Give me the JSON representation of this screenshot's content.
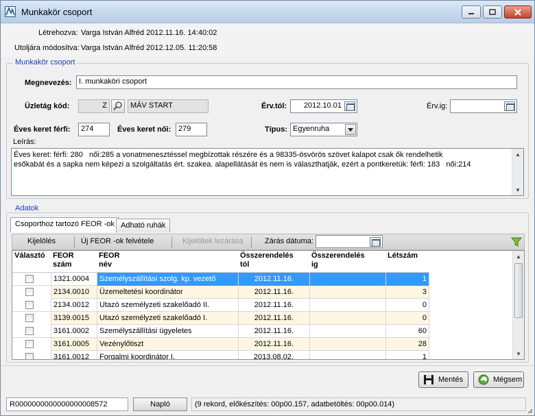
{
  "window": {
    "title": "Munkakör csoport",
    "icon": "app-icon"
  },
  "audit": {
    "created_label": "Létrehozva:",
    "created_value": "Varga István Alfréd 2012.11.16. 14:40:02",
    "modified_label": "Utoljára módosítva:",
    "modified_value": "Varga István Alfréd 2012.12.05. 11:20:58"
  },
  "group_main": {
    "title": "Munkakör csoport",
    "name_label": "Megnevezés:",
    "name_value": "I. munkaköri csoport",
    "branch_label": "Üzletág kód:",
    "branch_code": "Z",
    "branch_name": "MÁV START",
    "valid_from_label": "Érv.tól:",
    "valid_from_value": "2012.10.01",
    "valid_to_label": "Érv.ig:",
    "valid_to_value": "",
    "male_label": "Éves keret férfi:",
    "male_value": "274",
    "female_label": "Éves keret női:",
    "female_value": "279",
    "type_label": "Típus:",
    "type_value": "Egyenruha",
    "desc_label": "Leírás:",
    "desc_value": "Éves keret: férfi: 280   női:285 a vonatmenesztéssel megbízottak részére és a 98335-ösvörös szövet kalapot csak ők rendelhetik\nesőkabát és a sapka nem képezi a szolgáltatás ért. szakea. alapellátását és nem is választhatják, ezért a pontkeretük: férfi: 183   női:214"
  },
  "group_data": {
    "title": "Adatok",
    "tabs": [
      {
        "label": "Csoporthoz tartozó FEOR -ok"
      },
      {
        "label": "Adható ruhák"
      }
    ],
    "toolbar": {
      "select": "Kijelölés",
      "add_feor": "Új FEOR -ok felvétele",
      "close_selected": "Kijelöltek lezárása",
      "close_date_label": "Zárás dátuma:",
      "close_date_value": ""
    },
    "columns": [
      "Választó",
      "FEOR\nszám",
      "FEOR\nnév",
      "Összerendelés\ntól",
      "Összerendelés\nig",
      "Létszám"
    ],
    "rows": [
      {
        "code": "1321.0004",
        "name": "Személyszállítási szolg. kp. vezető",
        "from": "2012.11.16.",
        "to": "",
        "count": "1"
      },
      {
        "code": "2134.0010",
        "name": "Üzemeltetési koordinátor",
        "from": "2012.11.16.",
        "to": "",
        "count": "3"
      },
      {
        "code": "2134.0012",
        "name": "Utazó személyzeti szakelőadó II.",
        "from": "2012.11.16.",
        "to": "",
        "count": "0"
      },
      {
        "code": "3139.0015",
        "name": "Utazó személyzeti szakelőadó I.",
        "from": "2012.11.16.",
        "to": "",
        "count": "0"
      },
      {
        "code": "3161.0002",
        "name": "Személyszállítási ügyeletes",
        "from": "2012.11.16.",
        "to": "",
        "count": "60"
      },
      {
        "code": "3161.0005",
        "name": "Vezénylőtiszt",
        "from": "2012.11.16.",
        "to": "",
        "count": "28"
      },
      {
        "code": "3161.0012",
        "name": "Forgalmi koordinátor I.",
        "from": "2013.08.02.",
        "to": "",
        "count": "1"
      }
    ]
  },
  "buttons": {
    "save": "Mentés",
    "cancel": "Mégsem"
  },
  "status": {
    "record_id": "R0000000000000000008572",
    "log_button": "Napló",
    "info": "(9 rekord, előkészítés: 00p00.157, adatbetöltés: 00p00.014)"
  }
}
